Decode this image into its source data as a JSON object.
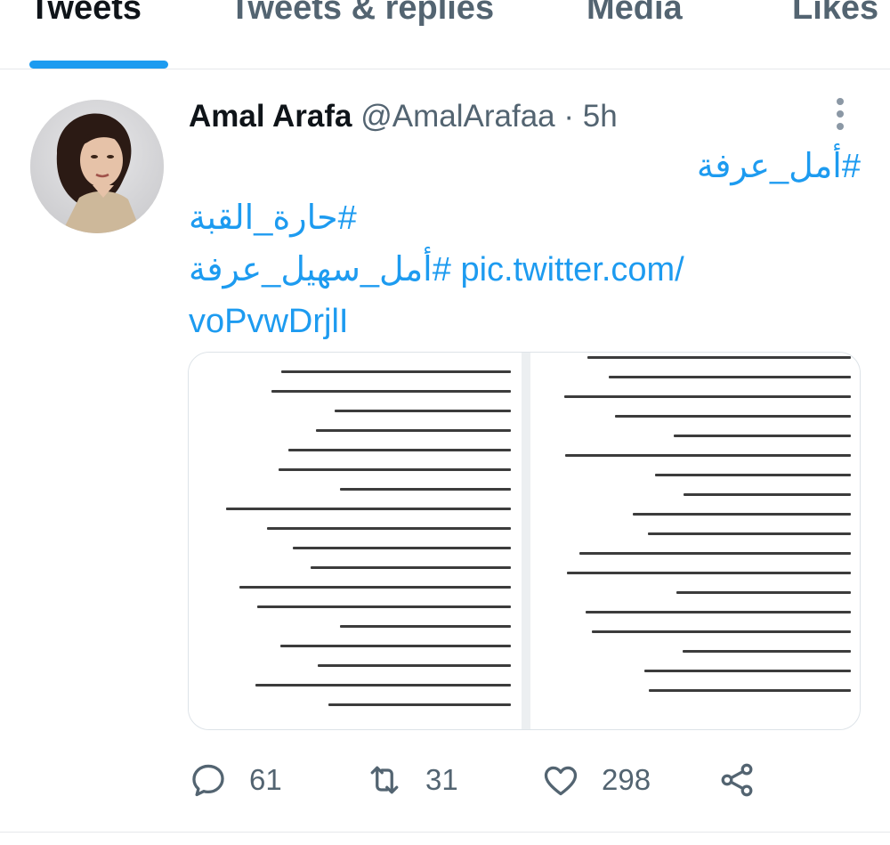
{
  "tabs": [
    {
      "label": "Tweets",
      "active": true
    },
    {
      "label": "Tweets & replies",
      "active": false
    },
    {
      "label": "Media",
      "active": false
    },
    {
      "label": "Likes",
      "active": false
    }
  ],
  "tweet": {
    "display_name": "Amal Arafa",
    "handle": "@AmalArafaa",
    "separator": "·",
    "time": "5h",
    "hashtag1": "#أمل_عرفة",
    "hashtag2": "#حارة_القبة",
    "hashtag3": "#أمل_سهيل_عرفة",
    "link_part1": "pic.twitter.com/",
    "link_part2": "voPvwDrjlI"
  },
  "actions": {
    "replies": "61",
    "retweets": "31",
    "likes": "298"
  },
  "icons": {
    "more": "more-vertical-icon",
    "reply": "reply-icon",
    "retweet": "retweet-icon",
    "like": "heart-icon",
    "share": "share-icon"
  },
  "colors": {
    "accent": "#1d9bf0",
    "secondary_text": "#536471",
    "primary_text": "#0f1419"
  }
}
